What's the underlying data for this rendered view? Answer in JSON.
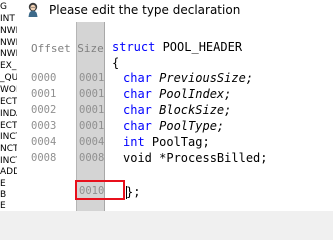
{
  "background_window": {
    "truncated_lines": [
      "G",
      "INT",
      "NWR",
      "NWR",
      "NWR",
      "EX_I",
      "_QU",
      "WOI",
      "ECT",
      "INDA",
      "ECT",
      "INCT",
      "NCT",
      "INCT",
      "ADD",
      "E",
      "B",
      "E"
    ]
  },
  "dialog": {
    "title": "Please edit the type declaration",
    "icon": "app-doll-icon"
  },
  "columns": {
    "offset_header": "Offset",
    "size_header": "Size"
  },
  "rows": [
    {
      "offset": "0000",
      "size": "0001"
    },
    {
      "offset": "0001",
      "size": "0001"
    },
    {
      "offset": "0002",
      "size": "0001"
    },
    {
      "offset": "0003",
      "size": "0001"
    },
    {
      "offset": "0004",
      "size": "0004"
    },
    {
      "offset": "0008",
      "size": "0008"
    },
    {
      "offset": "",
      "size": "0010"
    }
  ],
  "code": {
    "line0_kw": "struct",
    "line0_name": " POOL_HEADER",
    "line1": "{",
    "fields": [
      {
        "type": "char",
        "name": " PreviousSize;"
      },
      {
        "type": "char",
        "name": " PoolIndex;"
      },
      {
        "type": "char",
        "name": " BlockSize;"
      },
      {
        "type": "char",
        "name": " PoolType;"
      },
      {
        "type": "int",
        "name": " PoolTag;"
      },
      {
        "type": "void",
        "name": " *ProcessBilled;"
      }
    ],
    "closing": "};"
  },
  "colors": {
    "keyword": "#0000ff",
    "highlight": "#e8101c",
    "size_column_bg": "#d4d4d4"
  }
}
